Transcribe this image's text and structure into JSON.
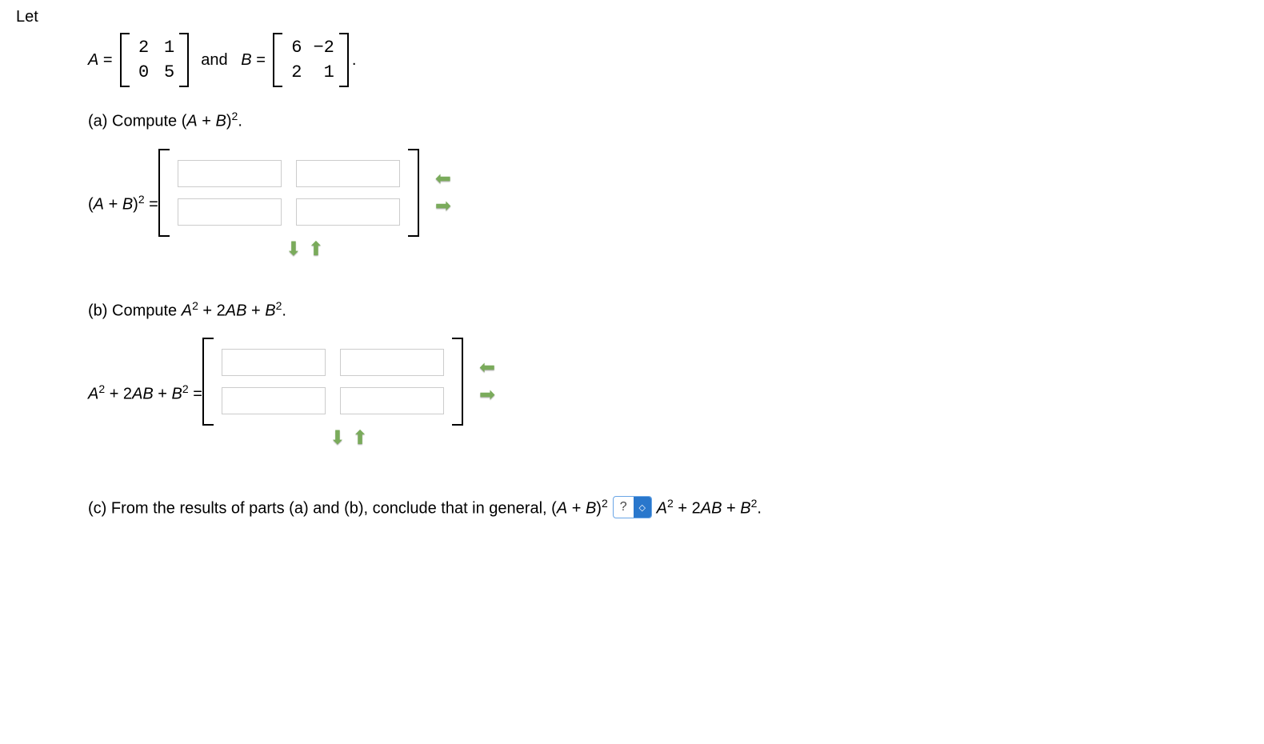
{
  "intro": "Let",
  "eqline": {
    "A_label": "A",
    "eq": "=",
    "and": "and",
    "B_label": "B",
    "period": "."
  },
  "matrixA": {
    "r1c1": "2",
    "r1c2": "1",
    "r2c1": "0",
    "r2c2": "5"
  },
  "matrixB": {
    "r1c1": "6",
    "r1c2": "−2",
    "r2c1": "2",
    "r2c2": "1"
  },
  "partA": {
    "label": "(a) Compute (",
    "expr_var1": "A",
    "plus": " + ",
    "expr_var2": "B",
    "close": ")",
    "sup": "2",
    "dot": ".",
    "lhs_open": "(",
    "lhs_A": "A",
    "lhs_plus": " + ",
    "lhs_B": "B",
    "lhs_close": ")",
    "lhs_sup": "2",
    "lhs_eq": " = "
  },
  "partB": {
    "label": "(b) Compute ",
    "A": "A",
    "sup2": "2",
    "plus1": " + 2",
    "AB_A": "A",
    "AB_B": "B",
    "plus2": " + ",
    "B": "B",
    "dot": ".",
    "lhs_A": "A",
    "lhs_sup1": "2",
    "lhs_plus1": " + 2",
    "lhs_AB_A": "A",
    "lhs_AB_B": "B",
    "lhs_plus2": " + ",
    "lhs_B": "B",
    "lhs_sup2": "2",
    "lhs_eq": " = "
  },
  "partC": {
    "text1": "(c) From the results of parts (a) and (b), conclude that in general,  (",
    "A": "A",
    "plus": " + ",
    "B": "B",
    "close": ")",
    "sup": "2",
    "select_placeholder": "?",
    "rhs_A": "A",
    "rhs_sup1": "2",
    "rhs_plus1": " + 2",
    "rhs_AB_A": "A",
    "rhs_AB_B": "B",
    "rhs_plus2": " + ",
    "rhs_B": "B",
    "rhs_sup2": "2",
    "rhs_dot": "."
  },
  "icons": {
    "arrow_left": "⬅",
    "arrow_right": "➡",
    "arrow_down": "⬇",
    "arrow_up": "⬆",
    "updown": "◇"
  }
}
